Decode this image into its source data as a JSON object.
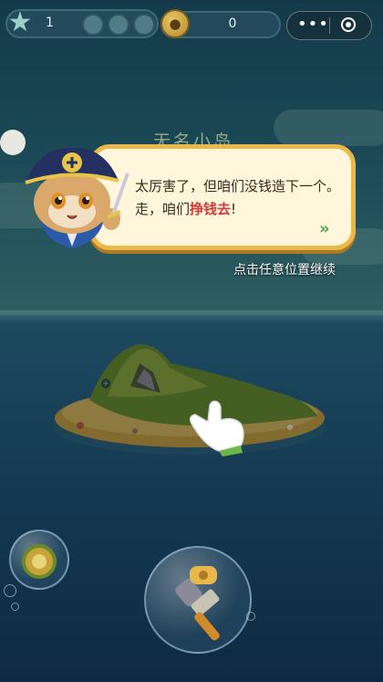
{
  "hud": {
    "level": "1",
    "paw_slots": 3,
    "coins": "0",
    "star_icon": "star-icon",
    "coin_icon": "paw-coin-icon",
    "menu_icon": "more-dots-icon",
    "close_icon": "target-close-icon"
  },
  "scene": {
    "island_name": "无名小岛"
  },
  "dialog": {
    "text_before": "太厉害了，但咱们没钱造下一个。走，咱们",
    "text_highlight": "挣钱去",
    "text_after": "!",
    "next_icon": "double-chevron-right-icon",
    "continue_hint": "点击任意位置继续"
  },
  "bubbles": {
    "small": "coin-bubble",
    "large": "hammer-bubble"
  },
  "colors": {
    "highlight": "#d43a3a",
    "dialog_border": "#e8b84a",
    "dialog_bg": "#fff6dc"
  }
}
